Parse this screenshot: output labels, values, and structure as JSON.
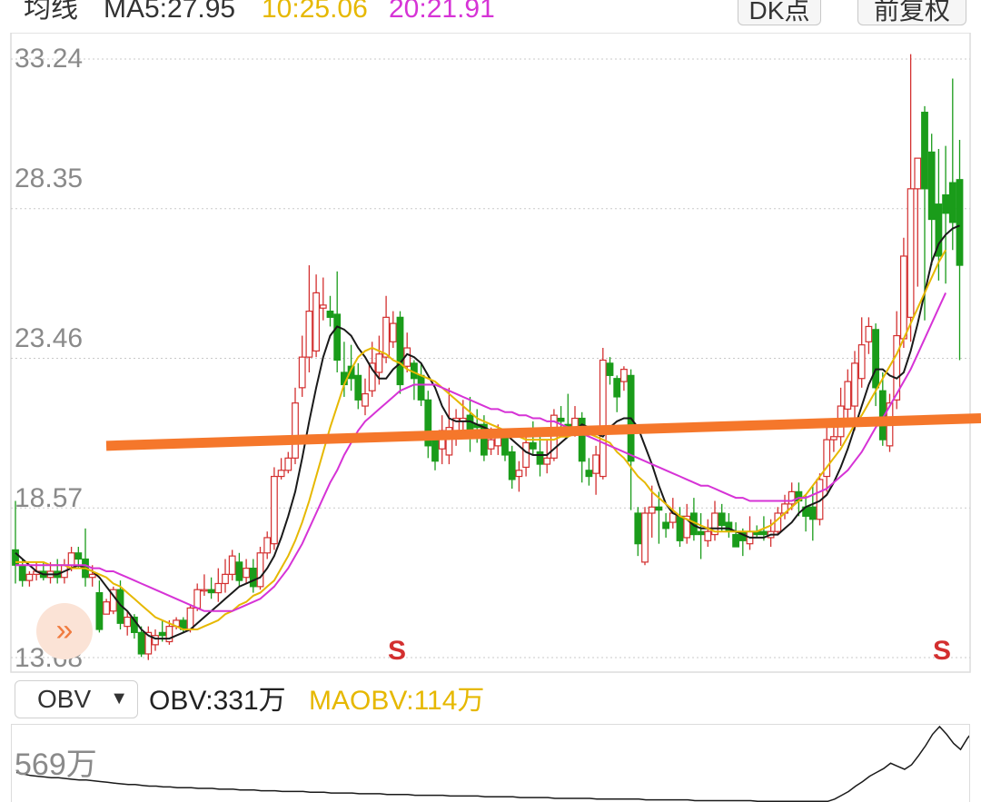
{
  "header": {
    "ma_title": "均线",
    "ma5": "MA5:27.95",
    "ma10": "10:25.06",
    "ma20": "20:21.91",
    "dk_button": "DK点",
    "fq_button": "前复权"
  },
  "colors": {
    "up": "#d32f2f",
    "down": "#1a9c1a",
    "ma5": "#1a1a1a",
    "ma10": "#e6b800",
    "ma20": "#d633d6",
    "trendline": "#f5772b",
    "grid": "#c9c9c9"
  },
  "y_axis": {
    "labels": [
      "33.24",
      "28.35",
      "23.46",
      "18.57",
      "13.68"
    ]
  },
  "signals": {
    "label": "S"
  },
  "expand_icon": "double-chevron-right-icon",
  "indicator": {
    "selected": "OBV",
    "obv_text": "OBV:331万",
    "maobv_text": "MAOBV:114万",
    "max_label": "569万"
  },
  "chart_data": {
    "type": "candlestick",
    "ylim": [
      13.68,
      33.24
    ],
    "yticks": [
      33.24,
      28.35,
      23.46,
      18.57,
      13.68
    ],
    "grid": true,
    "candles": [
      [
        17.2,
        16.7,
        18.8,
        16.1
      ],
      [
        16.7,
        16.2,
        16.9,
        16.0
      ],
      [
        16.2,
        16.4,
        16.5,
        16.0
      ],
      [
        16.4,
        16.5,
        16.8,
        16.2
      ],
      [
        16.5,
        16.3,
        16.8,
        16.2
      ],
      [
        16.3,
        16.5,
        16.8,
        16.1
      ],
      [
        16.5,
        16.3,
        16.9,
        16.1
      ],
      [
        16.3,
        16.7,
        16.9,
        16.1
      ],
      [
        16.7,
        17.1,
        17.3,
        16.5
      ],
      [
        17.1,
        16.9,
        17.3,
        16.6
      ],
      [
        16.9,
        16.3,
        17.9,
        16.0
      ],
      [
        16.3,
        16.4,
        16.7,
        16.0
      ],
      [
        15.8,
        14.6,
        16.2,
        14.5
      ],
      [
        15.1,
        15.5,
        15.6,
        15.1
      ],
      [
        15.2,
        15.9,
        16.0,
        15.1
      ],
      [
        15.9,
        14.8,
        16.2,
        14.6
      ],
      [
        14.7,
        15.0,
        15.2,
        14.4
      ],
      [
        15.0,
        14.5,
        15.1,
        14.3
      ],
      [
        14.5,
        13.8,
        14.7,
        13.7
      ],
      [
        13.8,
        14.5,
        14.7,
        13.6
      ],
      [
        14.1,
        14.4,
        14.6,
        13.9
      ],
      [
        14.5,
        14.4,
        14.9,
        14.2
      ],
      [
        14.2,
        14.7,
        14.9,
        14.1
      ],
      [
        14.7,
        14.9,
        15.0,
        14.6
      ],
      [
        14.9,
        14.6,
        15.0,
        14.5
      ],
      [
        14.6,
        15.3,
        15.4,
        14.5
      ],
      [
        15.3,
        15.9,
        16.1,
        15.2
      ],
      [
        15.9,
        15.9,
        16.4,
        15.7
      ],
      [
        15.9,
        15.8,
        16.3,
        15.6
      ],
      [
        15.8,
        16.1,
        16.6,
        15.5
      ],
      [
        16.1,
        16.4,
        16.9,
        15.8
      ],
      [
        16.4,
        17.0,
        17.2,
        16.2
      ],
      [
        16.8,
        16.2,
        17.1,
        16.0
      ],
      [
        16.3,
        16.6,
        16.9,
        16.1
      ],
      [
        16.6,
        16.0,
        16.9,
        15.8
      ],
      [
        16.0,
        17.1,
        17.3,
        15.9
      ],
      [
        17.1,
        17.6,
        17.8,
        16.9
      ],
      [
        17.4,
        19.6,
        19.9,
        17.2
      ],
      [
        19.6,
        19.8,
        20.2,
        19.5
      ],
      [
        19.8,
        20.2,
        20.4,
        19.7
      ],
      [
        20.2,
        22.0,
        22.5,
        20.0
      ],
      [
        22.5,
        23.5,
        24.2,
        22.2
      ],
      [
        23.5,
        25.0,
        26.5,
        23.0
      ],
      [
        23.7,
        25.6,
        26.2,
        23.5
      ],
      [
        25.1,
        25.2,
        26.1,
        24.7
      ],
      [
        25.0,
        24.8,
        25.5,
        24.5
      ],
      [
        24.9,
        23.4,
        26.3,
        23.0
      ],
      [
        23.0,
        22.6,
        24.0,
        22.2
      ],
      [
        23.2,
        22.8,
        23.9,
        22.4
      ],
      [
        22.9,
        22.1,
        23.3,
        21.8
      ],
      [
        21.9,
        22.3,
        22.8,
        21.6
      ],
      [
        22.4,
        23.3,
        24.0,
        22.2
      ],
      [
        23.0,
        23.6,
        24.2,
        22.6
      ],
      [
        23.5,
        24.8,
        25.5,
        23.3
      ],
      [
        24.0,
        24.6,
        25.0,
        23.8
      ],
      [
        24.8,
        22.6,
        25.0,
        22.3
      ],
      [
        23.2,
        23.8,
        24.3,
        23.0
      ],
      [
        23.3,
        22.8,
        23.4,
        22.1
      ],
      [
        22.9,
        22.1,
        23.3,
        21.9
      ],
      [
        22.1,
        20.6,
        22.4,
        20.2
      ],
      [
        20.8,
        20.1,
        21.0,
        19.8
      ],
      [
        20.5,
        21.1,
        21.6,
        20.0
      ],
      [
        20.3,
        21.2,
        22.5,
        20.0
      ],
      [
        21.0,
        21.5,
        21.8,
        20.6
      ],
      [
        21.4,
        21.5,
        22.1,
        21.0
      ],
      [
        21.6,
        21.0,
        22.2,
        20.4
      ],
      [
        21.3,
        21.2,
        21.8,
        20.7
      ],
      [
        21.3,
        20.3,
        21.6,
        20.1
      ],
      [
        20.5,
        20.8,
        21.2,
        20.3
      ],
      [
        20.6,
        20.9,
        21.3,
        20.3
      ],
      [
        20.9,
        20.3,
        21.1,
        20.1
      ],
      [
        20.4,
        19.5,
        20.6,
        19.2
      ],
      [
        19.6,
        19.8,
        20.1,
        19.1
      ],
      [
        19.9,
        20.7,
        21.1,
        19.6
      ],
      [
        20.7,
        20.5,
        21.4,
        20.3
      ],
      [
        20.4,
        20.0,
        21.1,
        19.6
      ],
      [
        20.0,
        20.2,
        20.8,
        19.7
      ],
      [
        20.2,
        21.6,
        21.8,
        20.1
      ],
      [
        21.5,
        21.4,
        21.9,
        21.2
      ],
      [
        21.3,
        21.1,
        22.3,
        20.9
      ],
      [
        21.1,
        21.5,
        21.9,
        20.9
      ],
      [
        21.5,
        20.1,
        21.7,
        19.4
      ],
      [
        19.8,
        19.6,
        20.2,
        19.3
      ],
      [
        19.7,
        20.3,
        20.6,
        19.0
      ],
      [
        19.6,
        23.4,
        23.8,
        19.5
      ],
      [
        23.3,
        22.9,
        23.5,
        22.6
      ],
      [
        22.8,
        22.2,
        22.9,
        21.7
      ],
      [
        22.7,
        23.1,
        23.2,
        22.4
      ],
      [
        22.9,
        20.1,
        23.1,
        18.5
      ],
      [
        18.4,
        17.4,
        18.6,
        17.0
      ],
      [
        16.8,
        18.4,
        18.6,
        16.7
      ],
      [
        18.4,
        18.6,
        19.3,
        17.6
      ],
      [
        18.6,
        18.5,
        19.1,
        17.4
      ],
      [
        18.1,
        17.9,
        18.4,
        17.6
      ],
      [
        18.1,
        18.4,
        18.9,
        17.9
      ],
      [
        18.3,
        17.5,
        18.6,
        17.3
      ],
      [
        17.6,
        18.3,
        18.7,
        17.4
      ],
      [
        18.4,
        17.7,
        18.9,
        17.5
      ],
      [
        17.8,
        17.7,
        18.4,
        16.9
      ],
      [
        17.5,
        17.8,
        18.2,
        17.3
      ],
      [
        17.7,
        18.4,
        18.8,
        17.5
      ],
      [
        18.4,
        18.0,
        18.7,
        17.8
      ],
      [
        18.1,
        17.8,
        18.4,
        17.6
      ],
      [
        17.7,
        17.3,
        18.1,
        17.3
      ],
      [
        17.8,
        17.5,
        17.9,
        17.0
      ],
      [
        17.4,
        17.8,
        18.3,
        17.2
      ],
      [
        17.8,
        17.7,
        18.0,
        17.6
      ],
      [
        17.8,
        17.7,
        18.3,
        17.5
      ],
      [
        17.6,
        17.8,
        18.2,
        17.3
      ],
      [
        17.8,
        18.4,
        18.6,
        17.7
      ],
      [
        18.4,
        18.7,
        19.0,
        18.2
      ],
      [
        18.7,
        19.1,
        19.4,
        18.5
      ],
      [
        19.1,
        18.8,
        19.4,
        18.3
      ],
      [
        18.6,
        18.3,
        19.0,
        17.8
      ],
      [
        18.6,
        18.2,
        19.3,
        17.5
      ],
      [
        18.2,
        19.5,
        19.7,
        18.0
      ],
      [
        19.6,
        20.8,
        21.5,
        19.1
      ],
      [
        20.8,
        20.9,
        21.2,
        20.4
      ],
      [
        20.9,
        21.9,
        22.5,
        20.6
      ],
      [
        21.8,
        22.7,
        23.1,
        21.3
      ],
      [
        21.9,
        23.3,
        23.7,
        21.1
      ],
      [
        22.8,
        23.9,
        24.8,
        22.5
      ],
      [
        24.0,
        24.5,
        24.8,
        23.6
      ],
      [
        24.4,
        22.5,
        24.6,
        21.9
      ],
      [
        22.4,
        20.8,
        23.0,
        20.6
      ],
      [
        20.6,
        22.0,
        22.3,
        20.4
      ],
      [
        22.1,
        24.2,
        25.0,
        21.8
      ],
      [
        24.1,
        26.8,
        27.4,
        23.8
      ],
      [
        24.8,
        29.0,
        33.4,
        24.0
      ],
      [
        29.0,
        30.0,
        30.0,
        25.8
      ],
      [
        31.5,
        29.0,
        31.7,
        24.7
      ],
      [
        30.2,
        28.0,
        30.8,
        26.5
      ],
      [
        28.5,
        26.8,
        30.3,
        26.0
      ],
      [
        28.8,
        28.2,
        30.4,
        25.9
      ],
      [
        29.2,
        27.9,
        32.6,
        27.0
      ],
      [
        29.3,
        26.5,
        30.6,
        23.4
      ]
    ],
    "series": [
      {
        "name": "MA5",
        "values": [
          17.1,
          16.9,
          16.7,
          16.5,
          16.4,
          16.4,
          16.4,
          16.5,
          16.6,
          16.7,
          16.6,
          16.5,
          16.3,
          16.0,
          15.7,
          15.4,
          15.2,
          14.9,
          14.6,
          14.4,
          14.3,
          14.3,
          14.3,
          14.4,
          14.5,
          14.6,
          14.8,
          15.0,
          15.2,
          15.4,
          15.6,
          15.8,
          16.0,
          16.1,
          16.2,
          16.3,
          16.6,
          17.0,
          17.6,
          18.3,
          19.1,
          20.2,
          21.4,
          22.5,
          23.5,
          24.2,
          24.5,
          24.4,
          24.2,
          23.8,
          23.5,
          23.1,
          22.8,
          22.8,
          23.1,
          23.3,
          23.6,
          23.5,
          23.3,
          22.9,
          22.5,
          21.9,
          21.5,
          21.4,
          21.4,
          21.4,
          21.3,
          21.2,
          21.1,
          21.0,
          21.0,
          20.8,
          20.6,
          20.4,
          20.3,
          20.3,
          20.3,
          20.5,
          20.7,
          20.9,
          21.1,
          21.3,
          21.2,
          21.0,
          20.9,
          21.2,
          21.4,
          21.5,
          21.5,
          21.2,
          20.6,
          20.0,
          19.3,
          18.7,
          18.4,
          18.3,
          18.2,
          18.0,
          17.9,
          17.9,
          17.9,
          17.9,
          17.9,
          17.8,
          17.7,
          17.6,
          17.6,
          17.6,
          17.7,
          17.7,
          17.9,
          18.1,
          18.4,
          18.6,
          18.7,
          18.8,
          19.0,
          19.4,
          19.9,
          20.5,
          21.2,
          21.9,
          22.6,
          23.1,
          23.1,
          22.9,
          22.8,
          23.0,
          23.7,
          24.6,
          25.6,
          26.6,
          27.2,
          27.5,
          27.7,
          27.8
        ]
      },
      {
        "name": "MA10",
        "values": [
          16.8,
          16.8,
          16.8,
          16.8,
          16.8,
          16.7,
          16.7,
          16.7,
          16.6,
          16.6,
          16.6,
          16.5,
          16.4,
          16.3,
          16.1,
          16.0,
          15.8,
          15.6,
          15.4,
          15.2,
          15.0,
          14.9,
          14.8,
          14.7,
          14.6,
          14.6,
          14.6,
          14.7,
          14.8,
          14.9,
          15.1,
          15.2,
          15.4,
          15.5,
          15.7,
          15.8,
          16.0,
          16.2,
          16.6,
          17.0,
          17.5,
          18.1,
          18.8,
          19.6,
          20.4,
          21.2,
          21.9,
          22.6,
          23.1,
          23.5,
          23.7,
          23.8,
          23.7,
          23.6,
          23.4,
          23.3,
          23.1,
          23.0,
          22.9,
          22.8,
          22.7,
          22.5,
          22.3,
          22.1,
          21.9,
          21.7,
          21.5,
          21.4,
          21.3,
          21.2,
          21.1,
          21.0,
          20.9,
          20.8,
          20.8,
          20.8,
          20.8,
          20.8,
          20.9,
          20.9,
          21.0,
          21.0,
          21.0,
          20.9,
          20.8,
          20.7,
          20.4,
          20.2,
          19.9,
          19.6,
          19.4,
          19.1,
          18.9,
          18.7,
          18.5,
          18.3,
          18.2,
          18.1,
          18.0,
          17.9,
          17.8,
          17.8,
          17.8,
          17.8,
          17.8,
          17.8,
          17.8,
          17.9,
          18.0,
          18.2,
          18.4,
          18.6,
          18.8,
          19.0,
          19.3,
          19.6,
          19.9,
          20.2,
          20.5,
          20.9,
          21.3,
          21.6,
          22.0,
          22.4,
          22.8,
          23.2,
          23.6,
          24.1,
          24.6,
          25.1,
          25.6,
          26.1,
          26.6,
          27.0
        ]
      },
      {
        "name": "MA20",
        "values": [
          16.7,
          16.7,
          16.7,
          16.7,
          16.7,
          16.7,
          16.7,
          16.7,
          16.7,
          16.7,
          16.7,
          16.6,
          16.6,
          16.5,
          16.5,
          16.4,
          16.3,
          16.2,
          16.1,
          16.0,
          15.9,
          15.8,
          15.7,
          15.6,
          15.5,
          15.4,
          15.3,
          15.2,
          15.2,
          15.2,
          15.2,
          15.2,
          15.3,
          15.4,
          15.5,
          15.6,
          15.8,
          16.0,
          16.3,
          16.6,
          17.0,
          17.4,
          17.9,
          18.4,
          18.9,
          19.4,
          19.8,
          20.3,
          20.7,
          21.1,
          21.4,
          21.6,
          21.8,
          22.0,
          22.2,
          22.4,
          22.5,
          22.6,
          22.6,
          22.6,
          22.6,
          22.5,
          22.4,
          22.3,
          22.2,
          22.1,
          22.0,
          21.9,
          21.8,
          21.8,
          21.7,
          21.7,
          21.6,
          21.6,
          21.5,
          21.5,
          21.4,
          21.4,
          21.3,
          21.2,
          21.1,
          21.0,
          20.9,
          20.8,
          20.7,
          20.6,
          20.5,
          20.4,
          20.3,
          20.2,
          20.1,
          20.0,
          19.9,
          19.8,
          19.7,
          19.6,
          19.5,
          19.4,
          19.3,
          19.3,
          19.2,
          19.1,
          19.0,
          18.9,
          18.9,
          18.8,
          18.8,
          18.8,
          18.8,
          18.8,
          18.8,
          18.8,
          18.9,
          18.9,
          19.0,
          19.1,
          19.2,
          19.4,
          19.6,
          19.8,
          20.1,
          20.4,
          20.8,
          21.2,
          21.5,
          21.9,
          22.3,
          22.7,
          23.1,
          23.6,
          24.1,
          24.6,
          25.1,
          25.6
        ]
      }
    ],
    "trendline": {
      "x_start": -2,
      "y_start": 20.6,
      "x_end": 139,
      "y_end": 21.5
    },
    "signals": [
      {
        "index": 52,
        "label": "S"
      },
      {
        "index": 136,
        "label": "S"
      }
    ],
    "obv_values": [
      40,
      38,
      36,
      35,
      34,
      33,
      33,
      32,
      31,
      30,
      30,
      29,
      28,
      27,
      26,
      25,
      24,
      24,
      23,
      22,
      22,
      21,
      21,
      20,
      20,
      20,
      19,
      19,
      19,
      18,
      18,
      18,
      17,
      17,
      17,
      16,
      16,
      16,
      15,
      15,
      15,
      15,
      14,
      14,
      14,
      13,
      13,
      13,
      13,
      12,
      12,
      12,
      12,
      11,
      11,
      11,
      11,
      10,
      10,
      10,
      10,
      10,
      9,
      9,
      9,
      9,
      9,
      8,
      8,
      8,
      8,
      8,
      7,
      7,
      7,
      7,
      7,
      6,
      6,
      6,
      6,
      6,
      6,
      5,
      5,
      5,
      5,
      5,
      5,
      5,
      4,
      4,
      4,
      4,
      4,
      4,
      4,
      3,
      3,
      3,
      3,
      3,
      3,
      3,
      3,
      3,
      2,
      2,
      2,
      2,
      2,
      2,
      2,
      2,
      2,
      2,
      2,
      5,
      10,
      15,
      22,
      28,
      35,
      40,
      45,
      52,
      48,
      44,
      50,
      62,
      75,
      90,
      100,
      90,
      78,
      70,
      85,
      96,
      88,
      80
    ]
  }
}
